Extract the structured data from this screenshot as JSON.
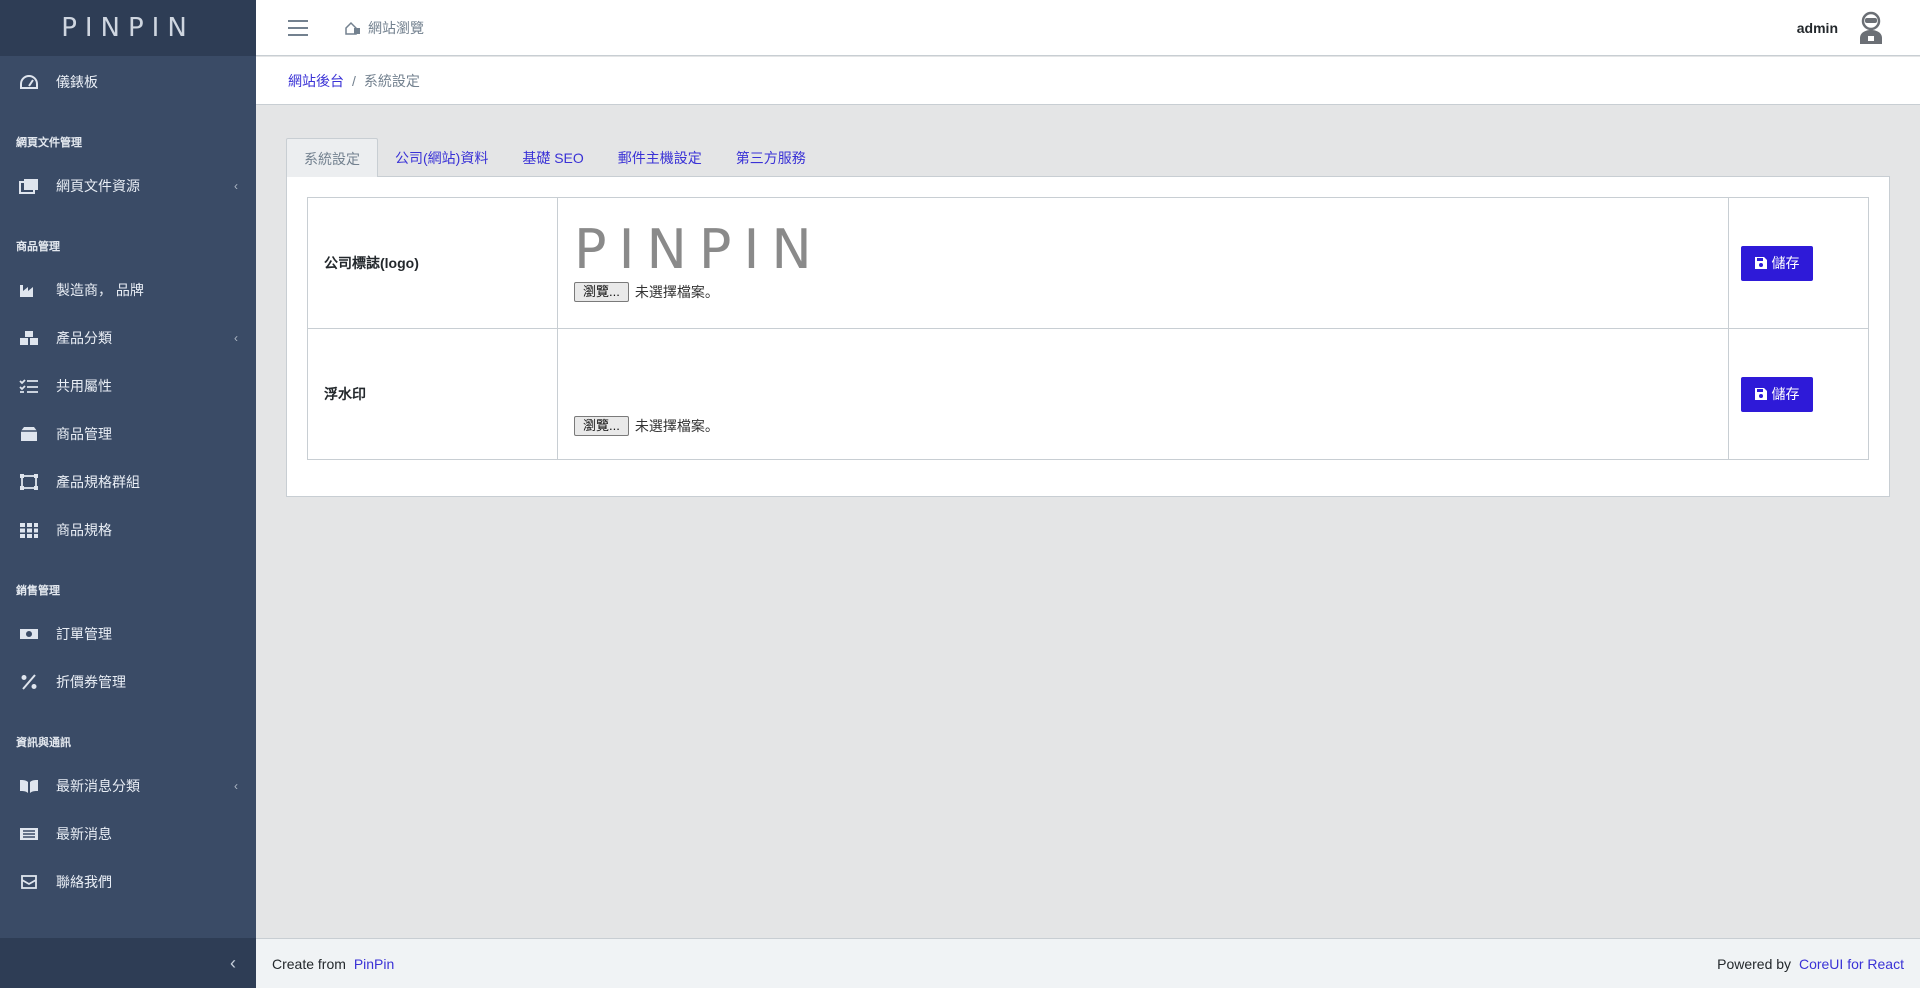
{
  "brand": "PINPIN",
  "sidebar": {
    "dashboard": "儀錶板",
    "section_web": "網頁文件管理",
    "web_resources": "網頁文件資源",
    "section_product": "商品管理",
    "manufacturer": "製造商， 品牌",
    "product_category": "產品分類",
    "common_attributes": "共用屬性",
    "product_management": "商品管理",
    "spec_groups": "產品規格群組",
    "specs": "商品規格",
    "section_sales": "銷售管理",
    "orders": "訂單管理",
    "coupons": "折價券管理",
    "section_news": "資訊與通訊",
    "news_category": "最新消息分類",
    "news": "最新消息",
    "contact": "聯絡我們",
    "collapse_icon": "chevron-left"
  },
  "header": {
    "site_browse": "網站瀏覽",
    "username": "admin"
  },
  "breadcrumb": {
    "root": "網站後台",
    "separator": "/",
    "current": "系統設定"
  },
  "tabs": [
    "系統設定",
    "公司(網站)資料",
    "基礎 SEO",
    "郵件主機設定",
    "第三方服務"
  ],
  "settings": {
    "logo_label": "公司標誌(logo)",
    "logo_preview_text": "PINPIN",
    "watermark_label": "浮水印",
    "browse_button": "瀏覽...",
    "no_file": "未選擇檔案。",
    "save_button": "儲存"
  },
  "footer": {
    "create_prefix": "Create from",
    "create_link": "PinPin",
    "powered_prefix": "Powered by",
    "powered_link": "CoreUI for React"
  },
  "colors": {
    "sidebar_bg": "#3a4b66",
    "primary_button": "#2e1ad8",
    "link": "#3a32d6"
  }
}
